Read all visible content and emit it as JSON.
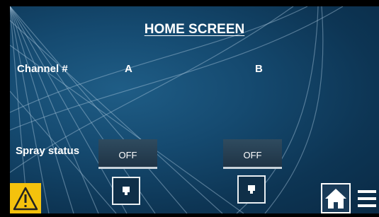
{
  "title": "HOME SCREEN",
  "channel_label": "Channel #",
  "channels": [
    {
      "name": "A",
      "status": "OFF"
    },
    {
      "name": "B",
      "status": "OFF"
    }
  ],
  "spray_label": "Spray status",
  "icons": [
    "warning-icon",
    "pump-icon",
    "home-icon",
    "menu-icon"
  ],
  "colors": {
    "background": "#154a70",
    "warning": "#f4c20d",
    "button": "#2f4b5f"
  }
}
